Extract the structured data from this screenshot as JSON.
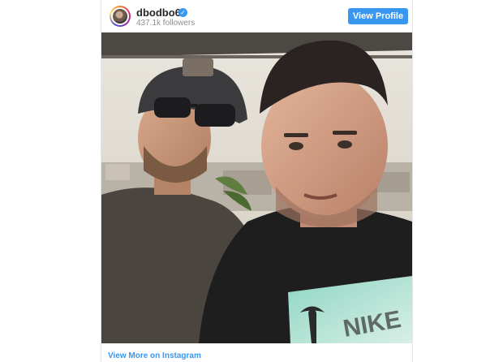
{
  "post": {
    "username": "dbodbo69",
    "followers": "437.1k followers",
    "view_profile_label": "View Profile",
    "view_more_label": "View More on Instagram",
    "photo_description": "Selfie of two men on a rooftop with a city in the background"
  },
  "colors": {
    "accent": "#3897f0",
    "username": "#262626",
    "muted": "#8e8e8e"
  },
  "icons": {
    "verified": "verified-badge-icon",
    "avatar": "profile-avatar"
  }
}
